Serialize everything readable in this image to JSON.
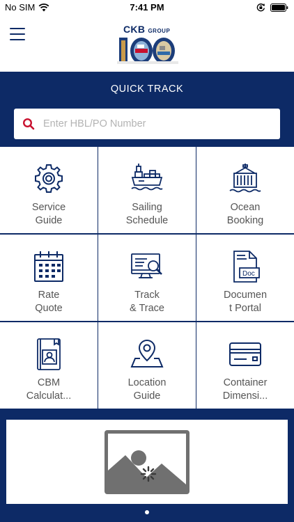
{
  "status_bar": {
    "carrier": "No SIM",
    "time": "7:41 PM"
  },
  "header": {
    "logo_main": "CKB",
    "logo_group": "GROUP",
    "logo_year": "100"
  },
  "quick_track": {
    "title": "QUICK TRACK",
    "search_placeholder": "Enter HBL/PO Number",
    "search_value": ""
  },
  "menu": {
    "items": [
      {
        "label": "Service\nGuide",
        "icon": "gear-icon"
      },
      {
        "label": "Sailing\nSchedule",
        "icon": "ship-icon"
      },
      {
        "label": "Ocean\nBooking",
        "icon": "container-icon"
      },
      {
        "label": "Rate\nQuote",
        "icon": "calendar-icon"
      },
      {
        "label": "Track\n& Trace",
        "icon": "monitor-search-icon"
      },
      {
        "label": "Documen\nt Portal",
        "icon": "document-icon"
      },
      {
        "label": "CBM\nCalculat...",
        "icon": "contact-book-icon"
      },
      {
        "label": "Location\nGuide",
        "icon": "map-pin-icon"
      },
      {
        "label": "Container\nDimensi...",
        "icon": "card-icon"
      }
    ]
  },
  "colors": {
    "primary": "#0d2a66",
    "accent": "#c8102e",
    "label": "#555555"
  },
  "carousel": {
    "image_icon": "image-placeholder-icon"
  }
}
